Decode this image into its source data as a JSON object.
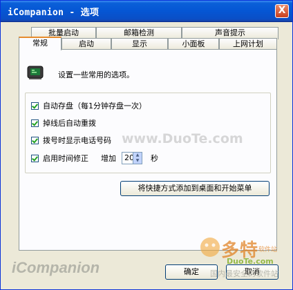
{
  "window": {
    "title": "iCompanion - 选项",
    "close_glyph": "X"
  },
  "tabs": {
    "row_back": [
      "批量启动",
      "邮箱检测",
      "声音提示"
    ],
    "row_front": [
      "常规",
      "启动",
      "显示",
      "小面板",
      "上网计划"
    ],
    "active": "常规"
  },
  "general": {
    "intro": "设置一些常用的选项。",
    "intro_icon": "terminal-monitor-icon",
    "options": [
      {
        "label": "自动存盘（每1分钟存盘一次）",
        "checked": true
      },
      {
        "label": "掉线后自动重拨",
        "checked": true
      },
      {
        "label": "拨号时显示电话号码",
        "checked": true
      },
      {
        "label": "启用时间修正",
        "checked": true
      }
    ],
    "time_correction": {
      "increase_label": "增加",
      "value": "20",
      "unit": "秒"
    },
    "shortcut_button": "将快捷方式添加到桌面和开始菜单"
  },
  "footer": {
    "brand": "iCompanion",
    "ok": "确定",
    "cancel": "取消"
  },
  "watermarks": {
    "center": "www.DuoTe.com",
    "logo_cn": "多特",
    "logo_sub": "软件站",
    "logo_en": "DuoTe.com",
    "logo_tag": "国内最安全的软件站"
  }
}
